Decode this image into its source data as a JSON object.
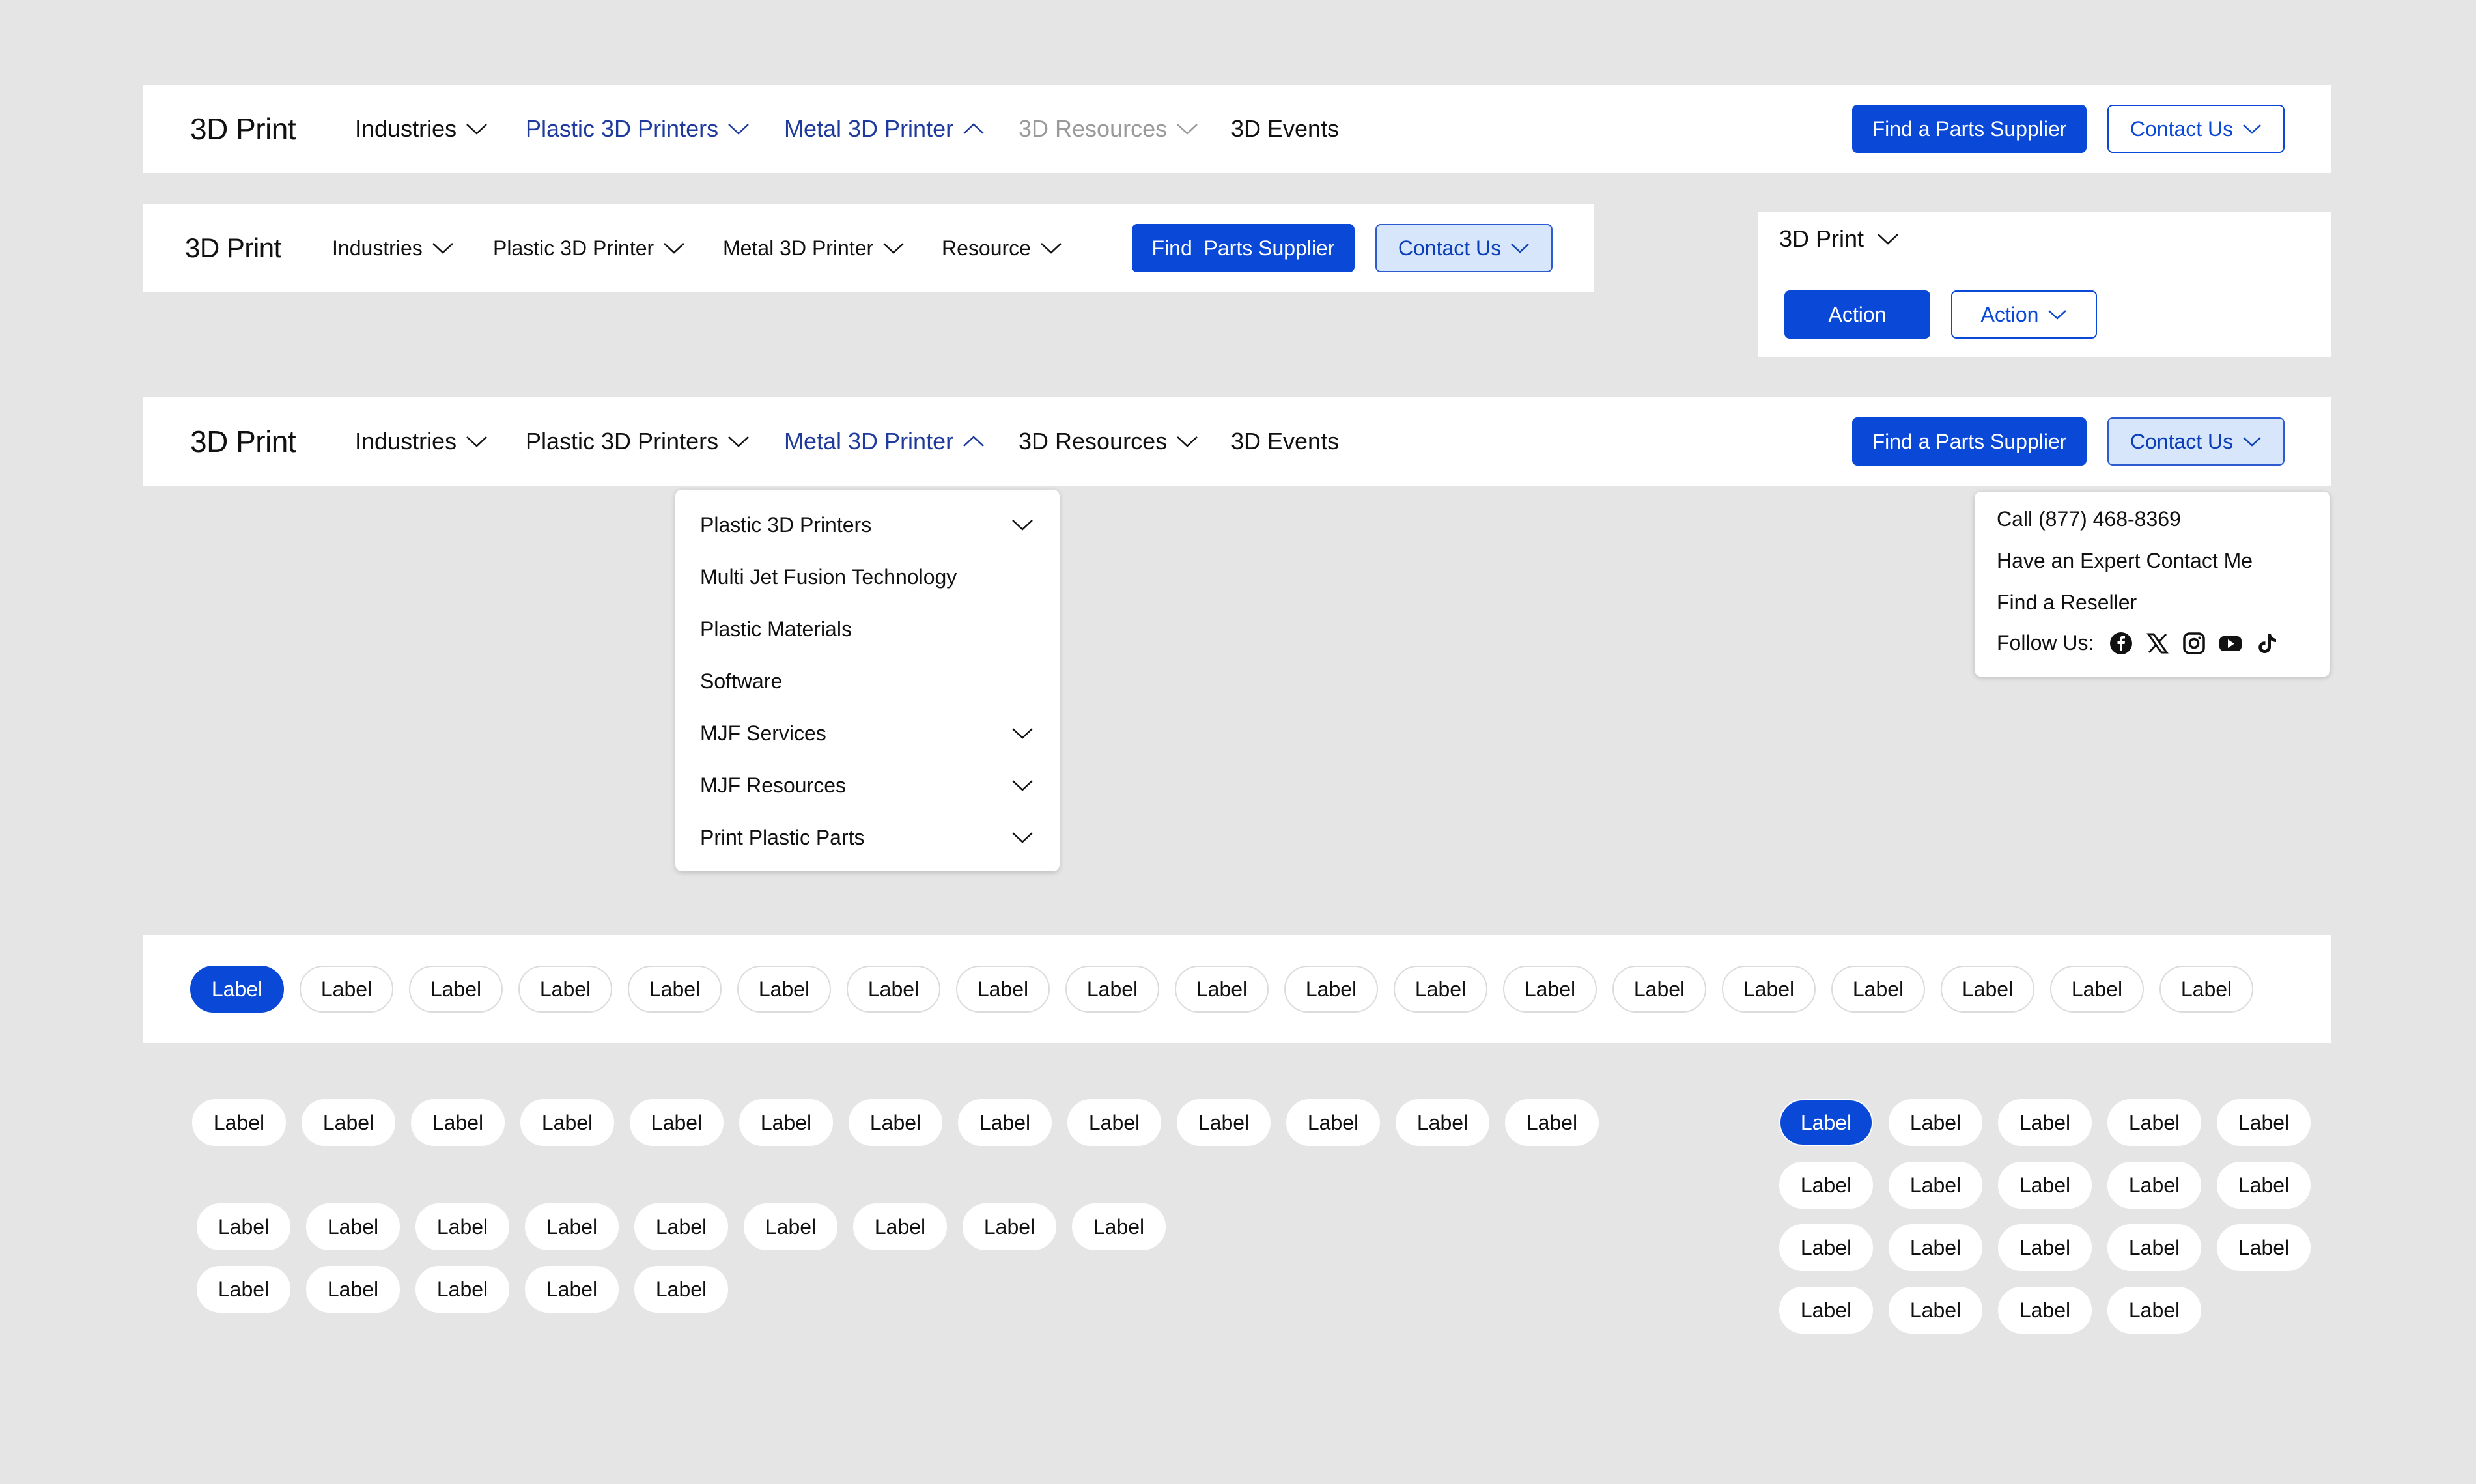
{
  "colors": {
    "background": "#e5e5e5",
    "primary": "#0a48d8",
    "active_nav": "#1e3a9c",
    "disabled_nav": "#9a9a9a",
    "soft_button": "#d7e6fb"
  },
  "nav1": {
    "brand": "3D Print",
    "items": [
      "Industries",
      "Plastic 3D Printers",
      "Metal 3D Printer",
      "3D Resources",
      "3D Events"
    ],
    "primary_button": "Find a Parts Supplier",
    "outline_button": "Contact Us"
  },
  "nav2": {
    "brand": "3D Print",
    "items": [
      "Industries",
      "Plastic 3D Printer",
      "Metal 3D Printer",
      "Resource"
    ],
    "primary_button": "Find  Parts Supplier",
    "outline_button": "Contact Us"
  },
  "mini_nav": {
    "brand": "3D Print",
    "primary_button": "Action",
    "outline_button": "Action"
  },
  "nav3": {
    "brand": "3D Print",
    "items": [
      "Industries",
      "Plastic 3D Printers",
      "Metal 3D Printer",
      "3D Resources",
      "3D Events"
    ],
    "primary_button": "Find a Parts Supplier",
    "outline_button": "Contact Us"
  },
  "metal_dropdown": {
    "items": [
      "Plastic 3D Printers",
      "Multi Jet Fusion Technology",
      "Plastic Materials",
      "Software",
      "MJF Services",
      "MJF Resources",
      "Print Plastic Parts"
    ]
  },
  "contact_dropdown": {
    "call": "Call (877) 468-8369",
    "expert": "Have an Expert Contact Me",
    "reseller": "Find a Reseller",
    "follow": "Follow Us:",
    "social_icons": [
      "facebook-icon",
      "x-icon",
      "instagram-icon",
      "youtube-icon",
      "tiktok-icon"
    ]
  },
  "chips": {
    "label": "Label",
    "row_white_panel_count": 19,
    "row_loose_count": 13,
    "wrap_row1_count": 9,
    "wrap_row2_count": 5,
    "grid_count": 19
  }
}
